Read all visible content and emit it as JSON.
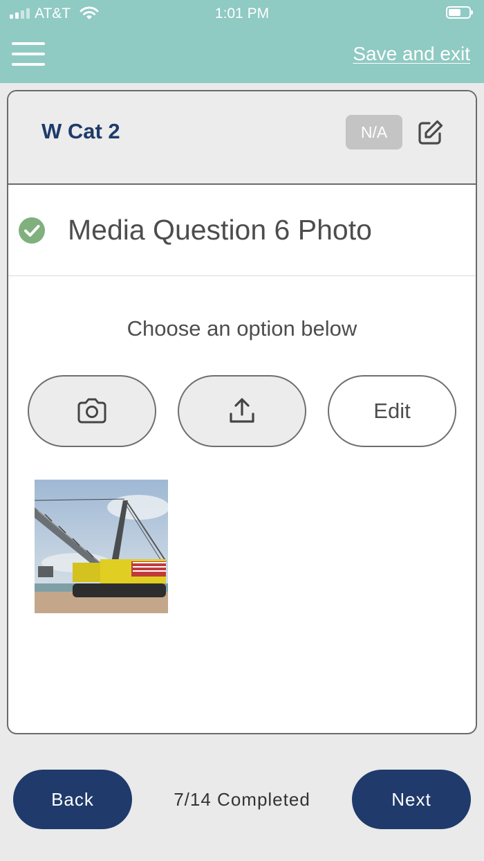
{
  "status_bar": {
    "carrier": "AT&T",
    "time": "1:01 PM"
  },
  "header": {
    "save_exit_label": "Save and exit",
    "accent_color": "#8fcac3"
  },
  "card": {
    "category_title": "W Cat 2",
    "na_label": "N/A",
    "question_title": "Media Question 6 Photo",
    "question_status": "completed",
    "instruction": "Choose an option below",
    "options": {
      "edit_label": "Edit"
    }
  },
  "footer": {
    "back_label": "Back",
    "next_label": "Next",
    "progress_text": "7/14 Completed",
    "button_color": "#1f3a6b"
  },
  "icons": [
    "menu-icon",
    "wifi-icon",
    "battery-icon",
    "pencil-square-icon",
    "check-circle-icon",
    "camera-icon",
    "upload-icon"
  ]
}
